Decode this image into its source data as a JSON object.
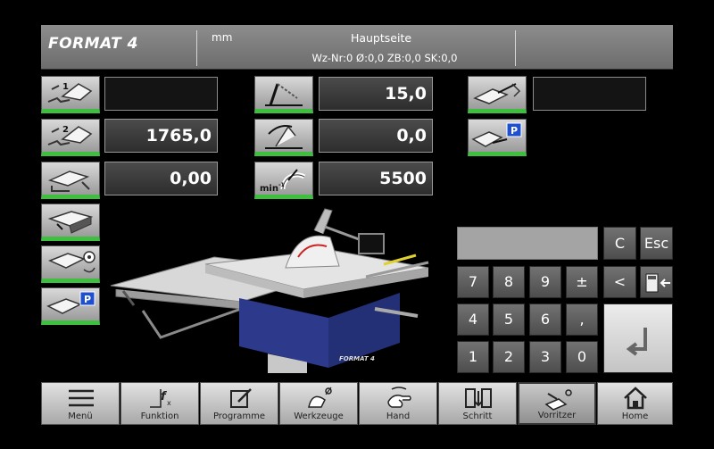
{
  "header": {
    "logo": "FORMAT 4",
    "unit": "mm",
    "title": "Hauptseite",
    "info": "Wz-Nr:0 Ø:0,0 ZB:0,0 SK:0,0"
  },
  "left_panel": {
    "fence1_value": "",
    "fence2_value": "1765,0",
    "height_value": "0,00",
    "saw_tilt_value": "15,0",
    "saw_angle_value": "0,0",
    "speed_value": "5500",
    "speed_unit": "min",
    "speed_exp": "-1",
    "aux_value": "",
    "fence1_index": "1",
    "fence2_index": "2",
    "park_badge": "P"
  },
  "keypad": {
    "display": "",
    "keys": [
      "C",
      "Esc",
      "7",
      "8",
      "9",
      "±",
      "<",
      "4",
      "5",
      "6",
      ",",
      "1",
      "2",
      "3",
      "0"
    ]
  },
  "toolbar": [
    {
      "label": "Menü",
      "icon": "menu-icon"
    },
    {
      "label": "Funktion",
      "icon": "function-icon"
    },
    {
      "label": "Programme",
      "icon": "edit-icon"
    },
    {
      "label": "Werkzeuge",
      "icon": "blade-icon"
    },
    {
      "label": "Hand",
      "icon": "hand-icon"
    },
    {
      "label": "Schritt",
      "icon": "step-icon"
    },
    {
      "label": "Vorritzer",
      "icon": "scoring-icon",
      "active": true
    },
    {
      "label": "Home",
      "icon": "home-icon"
    }
  ],
  "colors": {
    "accent_green": "#3fbf3f",
    "parking_blue": "#1f4fd1",
    "machine_blue": "#2d3a8c"
  }
}
